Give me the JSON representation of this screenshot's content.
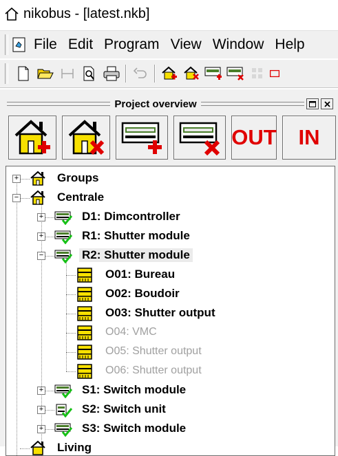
{
  "window": {
    "title": "nikobus - [latest.nkb]"
  },
  "menu": [
    "File",
    "Edit",
    "Program",
    "View",
    "Window",
    "Help"
  ],
  "toolbar": {
    "buttons": [
      "new-doc-icon",
      "open-folder-icon",
      "disabled-icon",
      "print-preview-icon",
      "print-icon",
      "undo-icon",
      "add-group-icon",
      "delete-group-icon",
      "add-module-icon",
      "delete-module-icon",
      "disabled-grid-icon",
      "out-icon"
    ]
  },
  "panel": {
    "title": "Project overview",
    "big_buttons": {
      "out_label": "OUT",
      "in_label": "IN"
    }
  },
  "tree": {
    "groups": "Groups",
    "centrale": "Centrale",
    "d1": "D1: Dimcontroller",
    "r1": "R1: Shutter module",
    "r2": "R2: Shutter module",
    "o01": "O01: Bureau",
    "o02": "O02: Boudoir",
    "o03": "O03: Shutter output",
    "o04": "O04: VMC",
    "o05": "O05: Shutter output",
    "o06": "O06: Shutter output",
    "s1": "S1: Switch module",
    "s2": "S2: Switch unit",
    "s3": "S3: Switch module",
    "living": "Living"
  },
  "colors": {
    "accent_red": "#e00000",
    "green_check": "#16c016",
    "yellow": "#f7e000"
  }
}
